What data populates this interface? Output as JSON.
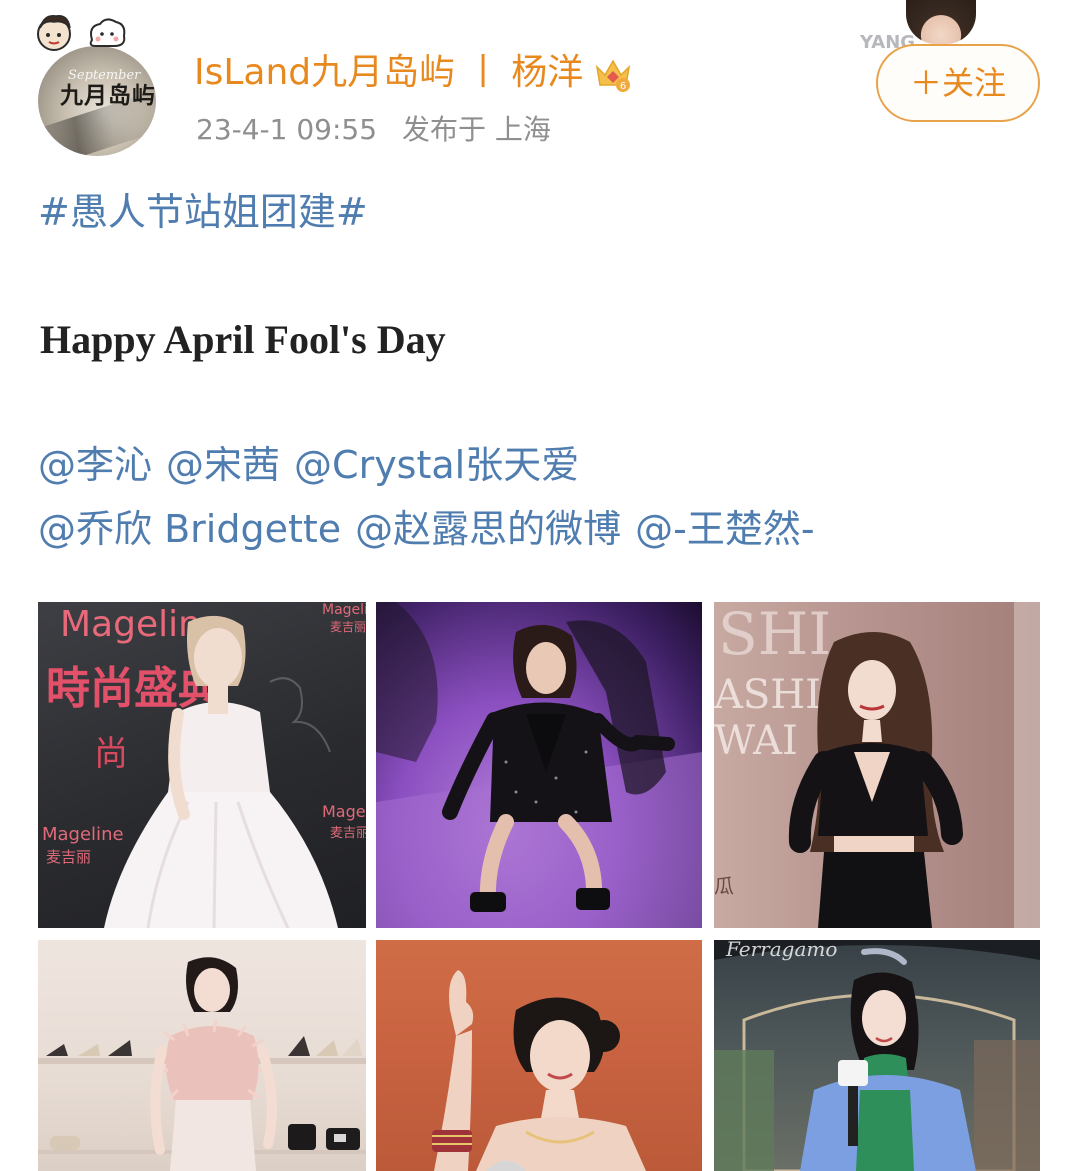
{
  "header": {
    "username": "IsLand九月岛屿",
    "separator": "丨",
    "linked_name": "杨洋",
    "timestamp": "23-4-1 09:55",
    "posted_from": "发布于 上海",
    "avatar_text": "九月岛屿",
    "avatar_script": "September",
    "badge_icon": "crown-badge-icon",
    "follow_label": "＋关注",
    "follow_card_text": "YANG"
  },
  "post": {
    "topic": "#愚人节站姐团建#",
    "headline": "Happy April Fool's Day",
    "mentions_line1": [
      "@李沁",
      "@宋茜",
      "@Crystal张天爱"
    ],
    "mentions_line2": [
      "@乔欣 Bridgette",
      "@赵露思的微博",
      "@-王楚然-"
    ]
  },
  "photos": {
    "p1_text_brand": "Mageline",
    "p1_text_cn": "時尚盛典",
    "p1_text_cn2": "尚",
    "p1_text_brand2": "Mageline",
    "p1_text_brand_cn": "麦吉丽",
    "p1_text_brand3": "Mageline",
    "p1_text_brand3_cn": "麦吉丽",
    "p1_text_brand4": "Mageli",
    "p1_text_brand4_cn": "麦吉丽",
    "p3_text1": "SHI",
    "p3_text2": "ASHIC",
    "p3_text3": "WAI",
    "p3_text4": "瓜"
  },
  "colors": {
    "username": "#e8891f",
    "link": "#507daf",
    "meta": "#8f8f8f",
    "follow_border": "#e8a24a"
  }
}
